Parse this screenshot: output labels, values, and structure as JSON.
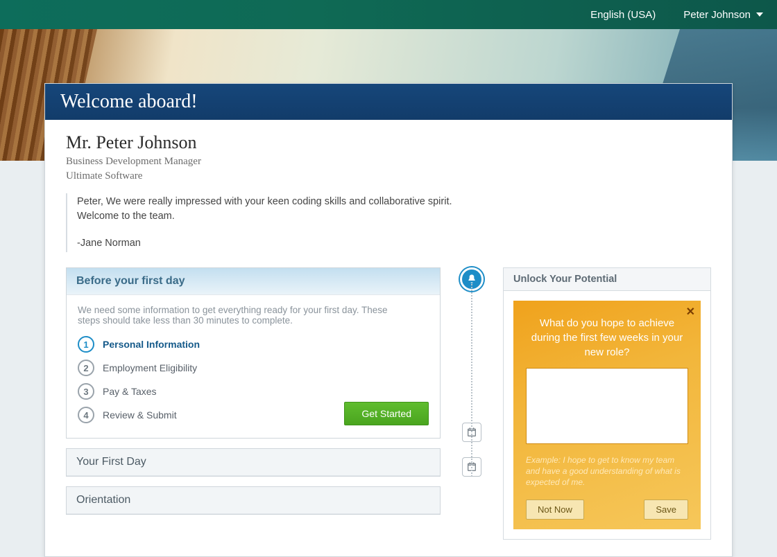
{
  "topbar": {
    "language": "English (USA)",
    "user": "Peter Johnson"
  },
  "card": {
    "welcome_title": "Welcome aboard!",
    "full_name": "Mr. Peter Johnson",
    "role": "Business Development Manager",
    "company": "Ultimate Software",
    "message_line1": "Peter, We were really impressed with your keen coding skills and collaborative spirit.",
    "message_line2": "Welcome to the team.",
    "signature": "-Jane Norman"
  },
  "onboarding": {
    "section1": {
      "title": "Before your first day",
      "desc": "We need some information to get everything ready for your first day. These steps should take less than 30 minutes to complete.",
      "steps": {
        "s1": "Personal Information",
        "s2": "Employment Eligibility",
        "s3": "Pay & Taxes",
        "s4": "Review & Submit"
      },
      "cta": "Get Started"
    },
    "section2_title": "Your First Day",
    "section3_title": "Orientation"
  },
  "potential": {
    "header": "Unlock Your Potential",
    "question": "What do you hope to achieve during the first few weeks in your new role?",
    "example": "Example: I hope to get to know my team and have a good understanding of what is expected of me.",
    "not_now": "Not Now",
    "save": "Save"
  }
}
